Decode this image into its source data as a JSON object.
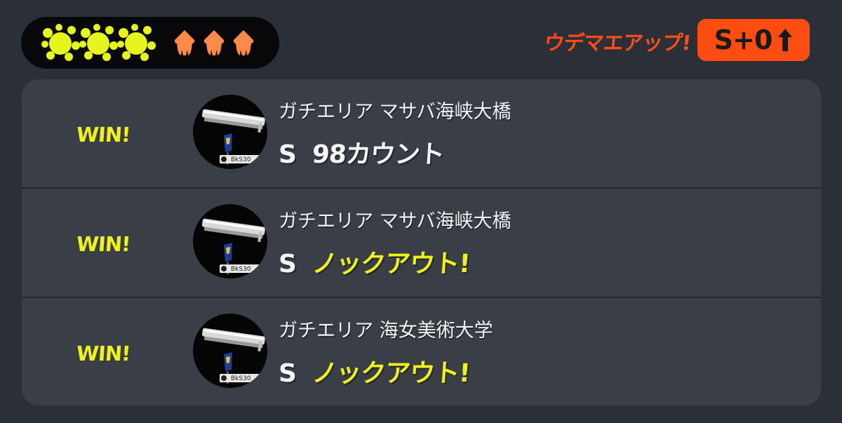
{
  "header": {
    "win_streak": [
      {
        "icon": "ink-splat-icon",
        "color": "#e6f51e"
      },
      {
        "icon": "ink-splat-icon",
        "color": "#e6f51e"
      },
      {
        "icon": "ink-splat-icon",
        "color": "#e6f51e"
      }
    ],
    "squids": [
      {
        "icon": "squid-icon",
        "color": "#ff8a4a"
      },
      {
        "icon": "squid-icon",
        "color": "#ff8a4a"
      },
      {
        "icon": "squid-icon",
        "color": "#ff8a4a"
      }
    ],
    "rank_up_label": "ウデマエアップ!",
    "rank_badge": {
      "label": "S+0",
      "icon": "up-arrow-icon"
    }
  },
  "colors": {
    "accent_orange": "#ff4d12",
    "win_yellow": "#eef21a",
    "panel_bg": "#3a3e47",
    "page_bg": "#2b2f37"
  },
  "results": [
    {
      "outcome": "WIN!",
      "weapon_icon": "carbon-roller-weapon-icon",
      "mode_stage": "ガチエリア マサバ海峡大橋",
      "rank": "S",
      "result": "98カウント",
      "knockout": false
    },
    {
      "outcome": "WIN!",
      "weapon_icon": "carbon-roller-weapon-icon",
      "mode_stage": "ガチエリア マサバ海峡大橋",
      "rank": "S",
      "result": "ノックアウト!",
      "knockout": true
    },
    {
      "outcome": "WIN!",
      "weapon_icon": "carbon-roller-weapon-icon",
      "mode_stage": "ガチエリア 海女美術大学",
      "rank": "S",
      "result": "ノックアウト!",
      "knockout": true
    }
  ]
}
